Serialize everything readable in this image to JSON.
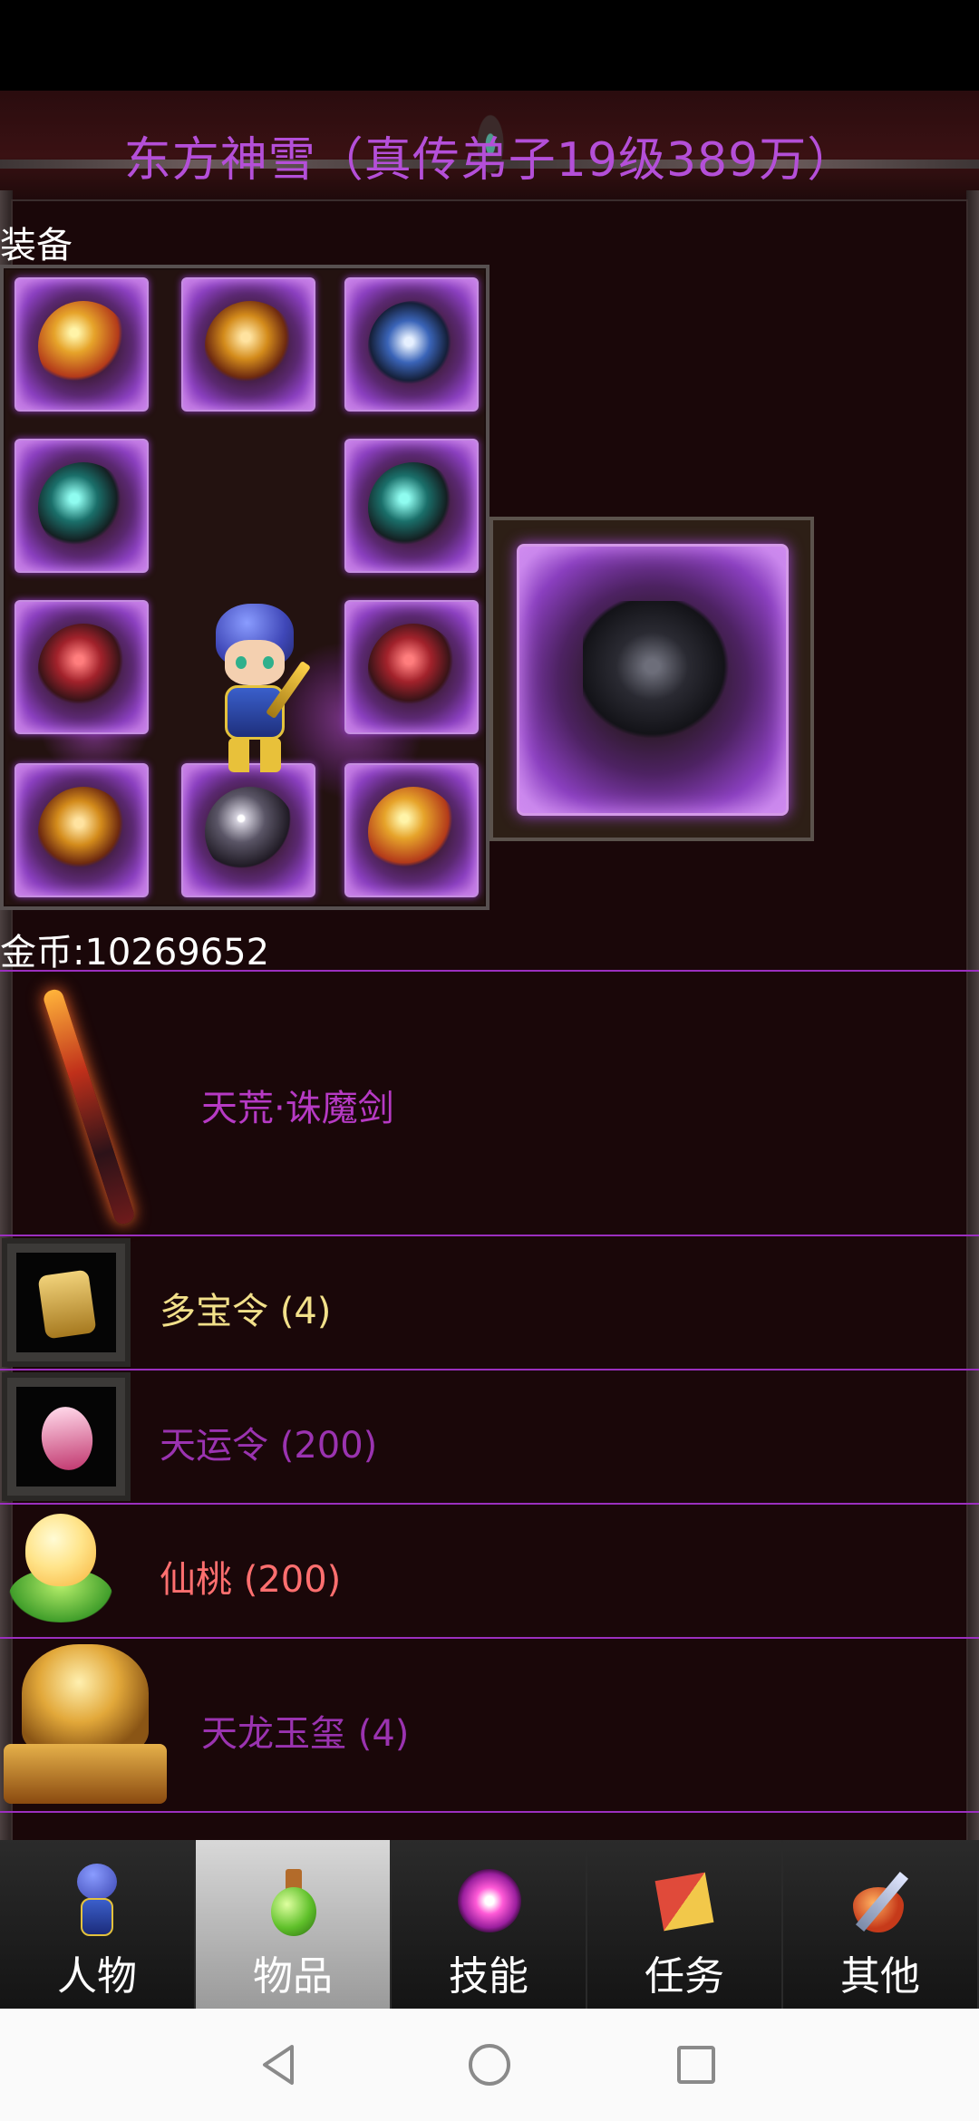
{
  "title": "东方神雪（真传弟子19级389万）",
  "equipment": {
    "section_label": "装备"
  },
  "gold": {
    "label": "金币:10269652"
  },
  "items": [
    {
      "name": "天荒·诛魔剑",
      "color": "#b63ac4",
      "icon": "sword-icon"
    },
    {
      "name": "多宝令 (4)",
      "color": "#f2e08a",
      "icon": "token-icon"
    },
    {
      "name": "天运令 (200)",
      "color": "#9a33b0",
      "icon": "pink-token-icon"
    },
    {
      "name": "仙桃 (200)",
      "color": "#ff6f6f",
      "icon": "peach-icon"
    },
    {
      "name": "天龙玉玺 (4)",
      "color": "#9a33b0",
      "icon": "seal-icon"
    }
  ],
  "tabs": [
    {
      "label": "人物",
      "icon": "character-icon",
      "active": false
    },
    {
      "label": "物品",
      "icon": "potion-icon",
      "active": true
    },
    {
      "label": "技能",
      "icon": "skill-orb-icon",
      "active": false
    },
    {
      "label": "任务",
      "icon": "quest-book-icon",
      "active": false
    },
    {
      "label": "其他",
      "icon": "sword-shield-icon",
      "active": false
    }
  ],
  "colors": {
    "title": "#b44fd8",
    "divider": "#9b2fbf",
    "panel_bg": "#1f0a0b",
    "active_tab": "#c0c0c0"
  }
}
